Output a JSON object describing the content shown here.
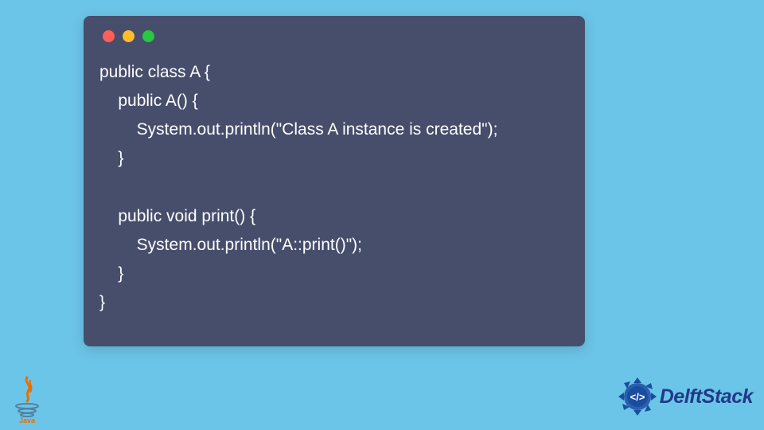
{
  "code": {
    "line1": "public class A {",
    "line2": "    public A() {",
    "line3": "        System.out.println(\"Class A instance is created\");",
    "line4": "    }",
    "line5": "",
    "line6": "    public void print() {",
    "line7": "        System.out.println(\"A::print()\");",
    "line8": "    }",
    "line9": "}"
  },
  "brand": {
    "name": "DelftStack"
  },
  "logos": {
    "java": "Java"
  }
}
